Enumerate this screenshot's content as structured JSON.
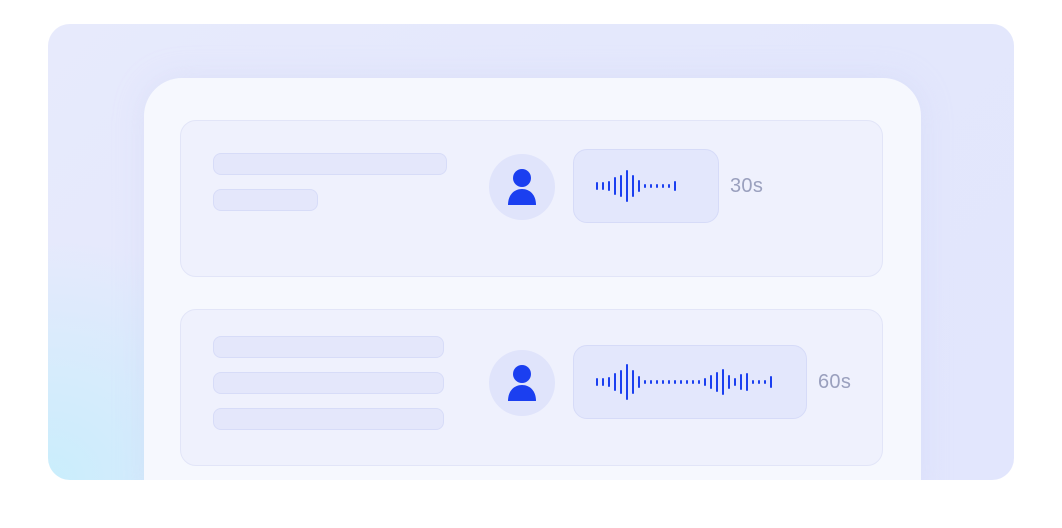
{
  "messages": [
    {
      "sender_icon": "user-icon",
      "voice_duration": "30s",
      "text_placeholder_lines": 2
    },
    {
      "sender_icon": "user-icon",
      "voice_duration": "60s",
      "text_placeholder_lines": 3
    }
  ],
  "colors": {
    "accent": "#1b3ff0",
    "duration_text": "#9aa0be",
    "card_background": "#eff1fd",
    "avatar_background": "#e0e4fb"
  }
}
